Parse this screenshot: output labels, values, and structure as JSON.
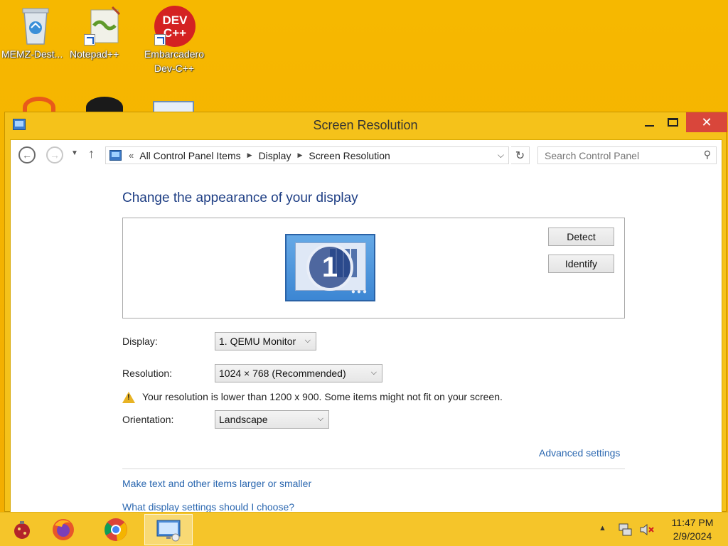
{
  "desktop": {
    "icons": [
      {
        "label": "MEMZ-Dest..."
      },
      {
        "label": "Notepad++"
      },
      {
        "label": "Embarcadero Dev-C++",
        "badge": "DEV C++"
      }
    ]
  },
  "window": {
    "title": "Screen Resolution",
    "close_glyph": "✕",
    "address": {
      "crumbs": [
        "All Control Panel Items",
        "Display",
        "Screen Resolution"
      ],
      "overflow": "«"
    },
    "search_placeholder": "Search Control Panel",
    "heading": "Change the appearance of your display",
    "preview": {
      "monitor_number": "1",
      "detect_label": "Detect",
      "identify_label": "Identify"
    },
    "display_label": "Display:",
    "display_value": "1. QEMU Monitor",
    "resolution_label": "Resolution:",
    "resolution_value": "1024 × 768 (Recommended)",
    "warning": "Your resolution is lower than 1200 x 900. Some items might not fit on your screen.",
    "orientation_label": "Orientation:",
    "orientation_value": "Landscape",
    "advanced_link": "Advanced settings",
    "link_text_size": "Make text and other items larger or smaller",
    "link_help": "What display settings should I choose?"
  },
  "taskbar": {
    "time": "11:47 PM",
    "date": "2/9/2024"
  },
  "colors": {
    "desktop_bg": "#f7b500",
    "heading": "#1e3e84",
    "link": "#2c68b0",
    "close": "#d9463b"
  }
}
